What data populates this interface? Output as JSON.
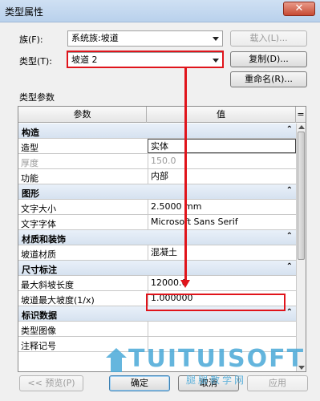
{
  "window": {
    "title": "类型属性",
    "close_glyph": "✕"
  },
  "family": {
    "label": "族(F):",
    "value": "系统族:坡道",
    "load_button": "载入(L)..."
  },
  "type": {
    "label": "类型(T):",
    "value": "坡道 2",
    "duplicate_button": "复制(D)...",
    "rename_button": "重命名(R)..."
  },
  "section_label": "类型参数",
  "grid": {
    "col_param": "参数",
    "col_value": "值",
    "col_eq": "=",
    "groups": [
      {
        "name": "构造",
        "rows": [
          {
            "name": "造型",
            "value": "实体"
          },
          {
            "name": "厚度",
            "value": "150.0"
          },
          {
            "name": "功能",
            "value": "内部"
          }
        ]
      },
      {
        "name": "图形",
        "rows": [
          {
            "name": "文字大小",
            "value": "2.5000 mm"
          },
          {
            "name": "文字字体",
            "value": "Microsoft Sans Serif"
          }
        ]
      },
      {
        "name": "材质和装饰",
        "rows": [
          {
            "name": "坡道材质",
            "value": "混凝土"
          }
        ]
      },
      {
        "name": "尺寸标注",
        "rows": [
          {
            "name": "最大斜坡长度",
            "value": "12000.0"
          },
          {
            "name": "坡道最大坡度(1/x)",
            "value": "1.000000"
          }
        ]
      },
      {
        "name": "标识数据",
        "rows": [
          {
            "name": "类型图像",
            "value": ""
          },
          {
            "name": "注释记号",
            "value": ""
          }
        ]
      }
    ],
    "collapse_glyph": "⌃"
  },
  "buttons": {
    "preview": "<< 预览(P)",
    "ok": "确定",
    "cancel": "取消",
    "apply": "应用"
  },
  "watermark": {
    "line1": "TUITUISOFT",
    "line2": "腿腿教学网"
  },
  "colors": {
    "highlight": "#e0141b",
    "group_bg": "#dde7f3"
  }
}
